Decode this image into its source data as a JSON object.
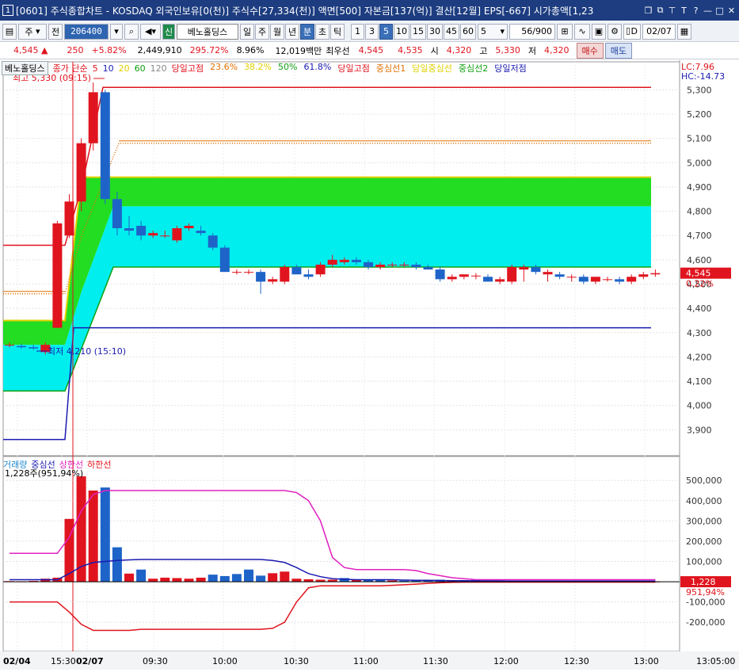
{
  "titlebar": {
    "num": "1",
    "title": "[0601] 주식종합차트 - KOSDAQ 외국인보유[0(천)] 주식수[27,334(천)] 액면[500] 자본금[137(억)] 결산[12월] EPS[-667] 시가총액[1,23",
    "icons": [
      "restore-icon",
      "link-icon",
      "pin-icon",
      "text-icon",
      "help-icon",
      "minimize-icon",
      "maximize-icon",
      "close-icon"
    ]
  },
  "toolbar": {
    "type_label": "주",
    "prev_label": "전",
    "code": "206400",
    "stock_name": "베노홀딩스",
    "sin_label": "신",
    "periods": [
      "일",
      "주",
      "월",
      "년",
      "분",
      "초",
      "틱"
    ],
    "selected_period": "분",
    "intervals": [
      "1",
      "3",
      "5",
      "10",
      "15",
      "30",
      "45",
      "60"
    ],
    "selected_interval": "5",
    "interval_value": "5",
    "count": "56/900",
    "date_check": "D",
    "date": "02/07"
  },
  "info": {
    "price": "4,545 ▲",
    "change": "250",
    "change_pct": "+5.82%",
    "volume": "2,449,910",
    "volume_pct": "295.72%",
    "turnover": "8.96%",
    "amount": "12,019백만",
    "best_label": "최우선",
    "best_ask": "4,545",
    "best_bid": "4,535",
    "open_label": "시",
    "open": "4,320",
    "high_label": "고",
    "high": "5,330",
    "low_label": "저",
    "low": "4,320",
    "buy_label": "매수",
    "sell_label": "매도"
  },
  "legend": {
    "stock_tag": "베노홀딩스",
    "ma_label": "종가 단순",
    "ma_periods": [
      "5",
      "10",
      "20",
      "60",
      "120"
    ],
    "items": [
      "당일고점",
      "23.6%",
      "38.2%",
      "50%",
      "61.8%",
      "당일고점",
      "중심선1",
      "당일중심선",
      "중심선2",
      "당일저점"
    ],
    "colors": {
      "당일고점": "#e0141e",
      "23.6%": "#e07000",
      "38.2%": "#e0d000",
      "50%": "#10a010",
      "61.8%": "#1a1ab0",
      "중심선1": "#e07000",
      "당일중심선": "#e0d000",
      "중심선2": "#10a010",
      "당일저점": "#1a1ab0"
    }
  },
  "annotations": {
    "high_note": "최고 5,330 (09:15)",
    "low_note": "최저 4,210 (15:10)",
    "lc": "LC:7.96",
    "hc": "HC:-14.73",
    "price_tag": "4,545",
    "price_tag_pct": "0.22%"
  },
  "volume_legend": {
    "items": [
      "거래량",
      "중심선",
      "상한선",
      "하한선"
    ],
    "colors": [
      "#1e8ad0",
      "#1a1ab0",
      "#e020c0",
      "#e0141e"
    ],
    "last_info": "1,228주(951,94%)",
    "tag": "1,228",
    "tag_pct": "951,94%"
  },
  "chart_data": [
    {
      "type": "candlestick",
      "title": "",
      "ylim": [
        3800,
        5350
      ],
      "yticks": [
        "5,300",
        "5,200",
        "5,100",
        "5,000",
        "4,900",
        "4,800",
        "4,700",
        "4,600",
        "4,500",
        "4,400",
        "4,300",
        "4,200",
        "4,100",
        "4,000",
        "3,900"
      ],
      "candles": [
        {
          "o": 4250,
          "h": 4260,
          "l": 4240,
          "c": 4250
        },
        {
          "o": 4245,
          "h": 4255,
          "l": 4235,
          "c": 4240
        },
        {
          "o": 4240,
          "h": 4250,
          "l": 4230,
          "c": 4235
        },
        {
          "o": 4220,
          "h": 4260,
          "l": 4210,
          "c": 4250
        },
        {
          "o": 4320,
          "h": 4760,
          "l": 4320,
          "c": 4750
        },
        {
          "o": 4700,
          "h": 4870,
          "l": 4690,
          "c": 4840
        },
        {
          "o": 4840,
          "h": 5100,
          "l": 4800,
          "c": 5080
        },
        {
          "o": 5080,
          "h": 5330,
          "l": 5050,
          "c": 5290
        },
        {
          "o": 5290,
          "h": 5300,
          "l": 4830,
          "c": 4850
        },
        {
          "o": 4850,
          "h": 4880,
          "l": 4700,
          "c": 4730
        },
        {
          "o": 4730,
          "h": 4780,
          "l": 4700,
          "c": 4720
        },
        {
          "o": 4740,
          "h": 4760,
          "l": 4680,
          "c": 4700
        },
        {
          "o": 4700,
          "h": 4720,
          "l": 4690,
          "c": 4710
        },
        {
          "o": 4700,
          "h": 4720,
          "l": 4690,
          "c": 4700
        },
        {
          "o": 4680,
          "h": 4740,
          "l": 4670,
          "c": 4730
        },
        {
          "o": 4730,
          "h": 4750,
          "l": 4720,
          "c": 4740
        },
        {
          "o": 4720,
          "h": 4740,
          "l": 4700,
          "c": 4710
        },
        {
          "o": 4700,
          "h": 4710,
          "l": 4640,
          "c": 4650
        },
        {
          "o": 4650,
          "h": 4660,
          "l": 4550,
          "c": 4550
        },
        {
          "o": 4550,
          "h": 4560,
          "l": 4540,
          "c": 4550
        },
        {
          "o": 4550,
          "h": 4560,
          "l": 4540,
          "c": 4550
        },
        {
          "o": 4550,
          "h": 4560,
          "l": 4460,
          "c": 4510
        },
        {
          "o": 4510,
          "h": 4530,
          "l": 4500,
          "c": 4520
        },
        {
          "o": 4510,
          "h": 4580,
          "l": 4500,
          "c": 4570
        },
        {
          "o": 4570,
          "h": 4580,
          "l": 4540,
          "c": 4540
        },
        {
          "o": 4540,
          "h": 4560,
          "l": 4520,
          "c": 4530
        },
        {
          "o": 4540,
          "h": 4590,
          "l": 4530,
          "c": 4580
        },
        {
          "o": 4580,
          "h": 4620,
          "l": 4570,
          "c": 4600
        },
        {
          "o": 4590,
          "h": 4610,
          "l": 4580,
          "c": 4600
        },
        {
          "o": 4600,
          "h": 4610,
          "l": 4580,
          "c": 4590
        },
        {
          "o": 4590,
          "h": 4600,
          "l": 4560,
          "c": 4570
        },
        {
          "o": 4570,
          "h": 4590,
          "l": 4560,
          "c": 4580
        },
        {
          "o": 4580,
          "h": 4590,
          "l": 4570,
          "c": 4580
        },
        {
          "o": 4580,
          "h": 4590,
          "l": 4570,
          "c": 4580
        },
        {
          "o": 4580,
          "h": 4590,
          "l": 4560,
          "c": 4570
        },
        {
          "o": 4570,
          "h": 4580,
          "l": 4560,
          "c": 4560
        },
        {
          "o": 4560,
          "h": 4570,
          "l": 4510,
          "c": 4520
        },
        {
          "o": 4520,
          "h": 4540,
          "l": 4510,
          "c": 4530
        },
        {
          "o": 4530,
          "h": 4540,
          "l": 4520,
          "c": 4540
        },
        {
          "o": 4535,
          "h": 4545,
          "l": 4520,
          "c": 4535
        },
        {
          "o": 4530,
          "h": 4540,
          "l": 4510,
          "c": 4510
        },
        {
          "o": 4510,
          "h": 4530,
          "l": 4500,
          "c": 4520
        },
        {
          "o": 4510,
          "h": 4580,
          "l": 4500,
          "c": 4570
        },
        {
          "o": 4560,
          "h": 4580,
          "l": 4510,
          "c": 4570
        },
        {
          "o": 4570,
          "h": 4580,
          "l": 4540,
          "c": 4550
        },
        {
          "o": 4540,
          "h": 4560,
          "l": 4510,
          "c": 4550
        },
        {
          "o": 4540,
          "h": 4550,
          "l": 4520,
          "c": 4530
        },
        {
          "o": 4530,
          "h": 4540,
          "l": 4510,
          "c": 4530
        },
        {
          "o": 4530,
          "h": 4540,
          "l": 4500,
          "c": 4510
        },
        {
          "o": 4510,
          "h": 4530,
          "l": 4500,
          "c": 4530
        },
        {
          "o": 4520,
          "h": 4530,
          "l": 4510,
          "c": 4520
        },
        {
          "o": 4520,
          "h": 4530,
          "l": 4500,
          "c": 4510
        },
        {
          "o": 4510,
          "h": 4540,
          "l": 4500,
          "c": 4530
        },
        {
          "o": 4530,
          "h": 4550,
          "l": 4520,
          "c": 4540
        },
        {
          "o": 4540,
          "h": 4560,
          "l": 4530,
          "c": 4545
        }
      ],
      "levels": {
        "day_high": 5310,
        "day_low": 4320,
        "prev_high": 4660,
        "prev_low": 3860,
        "center1": 5080,
        "center1_prev": 4460,
        "band_top_yellow": 4940,
        "band_green_low": 4820,
        "band_cyan_low": 4570,
        "prev_band_top": 4350,
        "prev_band_green_low": 4250,
        "prev_band_cyan_low": 4060
      },
      "xlabels": [
        "02/04",
        "15:30",
        "02/07",
        "09:30",
        "10:00",
        "10:30",
        "11:00",
        "11:30",
        "12:00",
        "12:30",
        "13:00",
        "13:05:00"
      ]
    },
    {
      "type": "bar",
      "title": "",
      "ylim": [
        -250000,
        540000
      ],
      "yticks": [
        "500,000",
        "400,000",
        "300,000",
        "200,000",
        "100,000",
        "0",
        "-100,000",
        "-200,000"
      ],
      "yvalues": [
        500000,
        400000,
        300000,
        200000,
        100000,
        0,
        -100000,
        -200000
      ],
      "volumes": [
        3000,
        2000,
        4000,
        15000,
        20000,
        310000,
        520000,
        450000,
        465000,
        170000,
        40000,
        60000,
        15000,
        20000,
        18000,
        15000,
        20000,
        35000,
        28000,
        38000,
        60000,
        30000,
        42000,
        50000,
        15000,
        12000,
        10000,
        10000,
        18000,
        10000,
        8000,
        8000,
        6000,
        5000,
        5000,
        6000,
        10000,
        5000,
        7000,
        10000,
        5000,
        4000,
        4000,
        3000,
        3000,
        3000,
        3000,
        3000,
        3000,
        2000,
        2000,
        2000,
        2000,
        2000,
        1228
      ],
      "up_flags": [
        1,
        1,
        1,
        1,
        1,
        1,
        1,
        1,
        0,
        0,
        1,
        0,
        1,
        1,
        1,
        1,
        1,
        0,
        0,
        0,
        0,
        0,
        1,
        1,
        1,
        1,
        1,
        1,
        0,
        1,
        0,
        0,
        1,
        0,
        0,
        0,
        0,
        1,
        0,
        0,
        1,
        1,
        0,
        1,
        0,
        0,
        1,
        0,
        1,
        1,
        0,
        1,
        1,
        1,
        1
      ],
      "upper": [
        140000,
        140000,
        140000,
        140000,
        140000,
        220000,
        350000,
        430000,
        450000,
        450000,
        450000,
        450000,
        450000,
        450000,
        450000,
        450000,
        450000,
        450000,
        450000,
        450000,
        450000,
        450000,
        450000,
        450000,
        440000,
        400000,
        300000,
        120000,
        70000,
        60000,
        60000,
        60000,
        60000,
        60000,
        55000,
        40000,
        30000,
        20000,
        15000,
        10000,
        10000,
        10000,
        10000,
        10000,
        10000,
        10000,
        10000,
        10000,
        10000,
        10000,
        10000,
        10000,
        10000,
        10000,
        10000
      ],
      "center": [
        10000,
        10000,
        10000,
        10000,
        10000,
        40000,
        75000,
        95000,
        100000,
        105000,
        108000,
        110000,
        110000,
        110000,
        110000,
        110000,
        110000,
        110000,
        110000,
        110000,
        110000,
        110000,
        105000,
        95000,
        70000,
        40000,
        25000,
        15000,
        12000,
        10000,
        10000,
        10000,
        10000,
        8000,
        7000,
        7000,
        6000,
        5000,
        5000,
        4000,
        4000,
        4000,
        3000,
        3000,
        3000,
        3000,
        3000,
        3000,
        3000,
        3000,
        3000,
        3000,
        3000,
        3000,
        3000
      ],
      "lower": [
        -100000,
        -100000,
        -100000,
        -100000,
        -100000,
        -150000,
        -210000,
        -240000,
        -240000,
        -240000,
        -240000,
        -235000,
        -235000,
        -235000,
        -235000,
        -235000,
        -235000,
        -235000,
        -235000,
        -235000,
        -235000,
        -235000,
        -230000,
        -200000,
        -100000,
        -30000,
        -20000,
        -20000,
        -20000,
        -20000,
        -20000,
        -20000,
        -18000,
        -15000,
        -12000,
        -8000,
        -5000,
        -3000,
        -2000,
        -2000,
        -2000,
        -2000,
        -2000,
        -2000,
        -2000,
        -2000,
        -2000,
        -2000,
        -2000,
        -2000,
        -2000,
        -2000,
        -2000,
        -2000,
        -2000
      ]
    }
  ]
}
